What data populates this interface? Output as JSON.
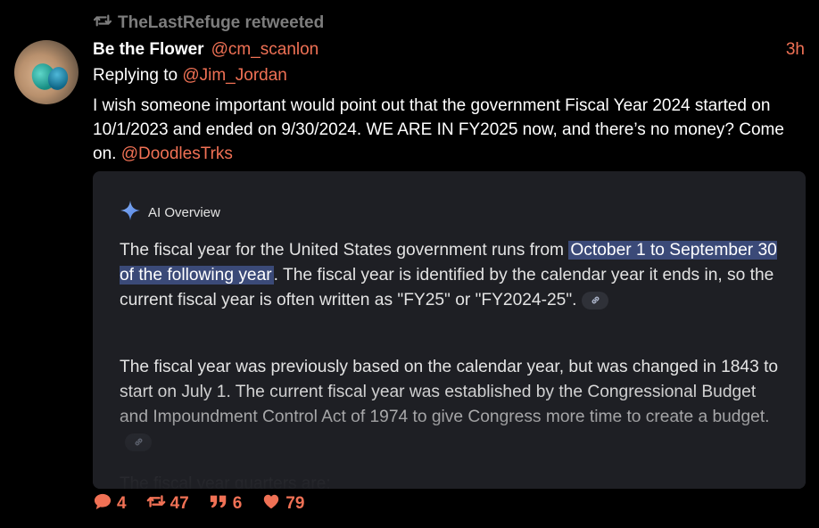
{
  "retweet": {
    "icon": "retweet-icon",
    "text": "TheLastRefuge retweeted"
  },
  "post": {
    "display_name": "Be the Flower",
    "handle": "@cm_scanlon",
    "time": "3h",
    "replying_prefix": "Replying to ",
    "replying_to": "@Jim_Jordan",
    "text": "I wish someone important would point out that the government Fiscal Year 2024 started on 10/1/2023 and ended on 9/30/2024. WE ARE IN FY2025 now, and there’s no money? Come on. ",
    "mention": "@DoodlesTrks"
  },
  "media": {
    "ai_label": "AI Overview",
    "p1_before": "The fiscal year for the United States government runs from ",
    "p1_highlight": "October 1 to September 30 of the following year",
    "p1_after": ". The fiscal year is identified by the calendar year it ends in, so the current fiscal year is often written as \"FY25\" or \"FY2024-25\".",
    "p2": "The fiscal year was previously based on the calendar year, but was changed in 1843 to start on July 1. The current fiscal year was established by the Congressional Budget and Impoundment Control Act of 1974 to give Congress more time to create a budget.",
    "p3": "The fiscal year quarters are:"
  },
  "actions": {
    "replies": "4",
    "retweets": "47",
    "quotes": "6",
    "likes": "79"
  },
  "colors": {
    "accent": "#f07155",
    "muted": "#7d7d7d",
    "background": "#000000",
    "card": "#1e1f24",
    "highlight": "#3b4a78"
  }
}
